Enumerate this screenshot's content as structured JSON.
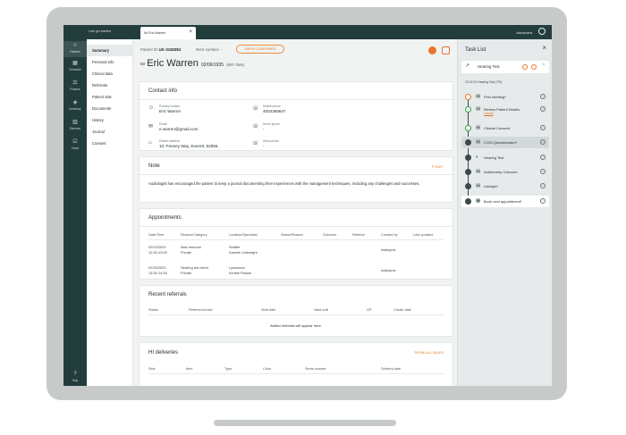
{
  "topbar": {
    "lets_get_started": "Lets get started",
    "tab_title": "Mr Eric Warren",
    "tab_close": "×",
    "advanced": "Advanced"
  },
  "rail": [
    {
      "label": "Patients",
      "icon": "patients-icon"
    },
    {
      "label": "Schedule",
      "icon": "calendar-icon"
    },
    {
      "label": "Finance",
      "icon": "finance-icon"
    },
    {
      "label": "Inventory",
      "icon": "inventory-icon"
    },
    {
      "label": "Discover",
      "icon": "chart-icon"
    },
    {
      "label": "Tasks",
      "icon": "tasks-icon"
    },
    {
      "label": "Help",
      "icon": "help-icon"
    }
  ],
  "subnav": [
    "Summary",
    "Personal info",
    "Clinical data",
    "Referrals",
    "Patient sale",
    "Documents",
    "History",
    "Journal",
    "Consent"
  ],
  "patient": {
    "id_label": "Patient ID",
    "id_value": "UK-3182852",
    "nhs": "NHS number: -",
    "gdpr": "GDPR CONFIRMED",
    "title": "Mr",
    "name": "Eric Warren",
    "dob": "02/06/1935",
    "age": "(88Y 0Ms)"
  },
  "contact": {
    "title": "Contact info",
    "primary_label": "Primary contact",
    "primary_value": "Eric Warren",
    "email_label": "Email",
    "email_value": "e.warren@gmail.com",
    "address_label": "Patient address",
    "address_value": "10, Fenney Way, Everett, 52555,",
    "mobile_label": "Mobile phone",
    "mobile_value": "4004368647",
    "home_label": "Home phone",
    "home_value": "-",
    "work_label": "Work phone",
    "work_value": "-"
  },
  "note": {
    "title": "Note",
    "edit": "EDIT",
    "text": "Audiologist has encouraged the patient to keep a journal documenting their experiences with the management techniques, including any challenges and successes."
  },
  "appointments": {
    "title": "Appointments",
    "columns": [
      "Date/Time",
      "Reason/Category",
      "Location/Specialist",
      "Status/Reason",
      "Outcome",
      "Referral",
      "Created by",
      "Last updated"
    ],
    "rows": [
      {
        "date": "02/22/2023",
        "time": "12:30-13:00",
        "reason": "Wax removal",
        "category": "Private",
        "location": "Seattle",
        "specialist": "Kamille Cartwright",
        "created_by": "maksymk"
      },
      {
        "date": "02/15/2023",
        "time": "13:30-14:00",
        "reason": "Hearing aid check",
        "category": "Private",
        "location": "Lynnwood",
        "specialist": "Kimble Russel",
        "created_by": "maksymk"
      }
    ]
  },
  "referrals": {
    "title": "Recent referrals",
    "columns": [
      "Status",
      "Referral service",
      "Start date",
      "Valid until",
      "GP",
      "Create date"
    ],
    "empty": "Added referrals will appear here."
  },
  "hi": {
    "title": "HI deliveries",
    "show_all": "SHOW ALL SALES",
    "columns": [
      "Side",
      "Item",
      "Type",
      "Color",
      "Serial number",
      "Delivery date"
    ]
  },
  "tasklist": {
    "title": "Task List",
    "close": "×",
    "header": "Hearing Test",
    "subtitle": "23.02.23 Hearing Test (7/9)",
    "tasks": [
      {
        "label": "First meeting*",
        "state": "orange"
      },
      {
        "label": "Review Patient Details",
        "cancel": "Cancel",
        "state": "green"
      },
      {
        "label": "Clinical Consent",
        "state": "green"
      },
      {
        "label": "COSI Questionnaire*",
        "state": "dark"
      },
      {
        "label": "Hearing Test",
        "state": "dark"
      },
      {
        "label": "Audiometry Outcome",
        "state": "dark"
      },
      {
        "label": "Lifestyle*",
        "state": "dark"
      },
      {
        "label": "Book next appointment*",
        "state": "dark"
      }
    ]
  },
  "colors": {
    "rail": "#233d3d",
    "accent": "#e9742a",
    "success": "#2f9e4a"
  }
}
